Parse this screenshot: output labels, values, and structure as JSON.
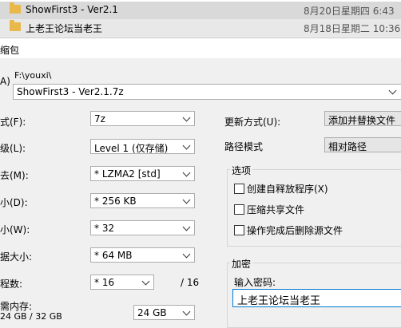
{
  "explorer": {
    "files": [
      {
        "name": "ShowFirst3  - Ver2.1",
        "date": "8月20日星期四 6:43"
      },
      {
        "name": "上老王论坛当老王",
        "date": "8月18日星期二 10:36"
      }
    ]
  },
  "dialog": {
    "title": "缩包",
    "archive_label": "A)",
    "archive_path": "F:\\youxi\\",
    "archive_name": "ShowFirst3  - Ver2.1.7z",
    "left": [
      {
        "label": "式(F):",
        "value": "7z"
      },
      {
        "label": "级(L):",
        "value": "Level 1 (仅存储)"
      },
      {
        "label": "去(M):",
        "value": "*  LZMA2 [std]"
      },
      {
        "label": "小(D):",
        "value": "*  256 KB"
      },
      {
        "label": "小(W):",
        "value": "*  32"
      },
      {
        "label": "据大小:",
        "value": "*  64 MB"
      },
      {
        "label": "程数:",
        "value": "*  16",
        "suffix": "/ 16"
      }
    ],
    "memory": {
      "label": "需内存:",
      "detail": "24 GB / 32 GB",
      "value": "24 GB"
    },
    "update_mode": {
      "label": "更新方式(U):",
      "value": "添加并替换文件"
    },
    "path_mode": {
      "label": "路径模式",
      "value": "相对路径"
    },
    "options": {
      "title": "选项",
      "items": [
        "创建自释放程序(X)",
        "压缩共享文件",
        "操作完成后删除源文件"
      ]
    },
    "encryption": {
      "title": "加密",
      "password_label": "输入密码:",
      "password_value": "上老王论坛当老王"
    }
  }
}
